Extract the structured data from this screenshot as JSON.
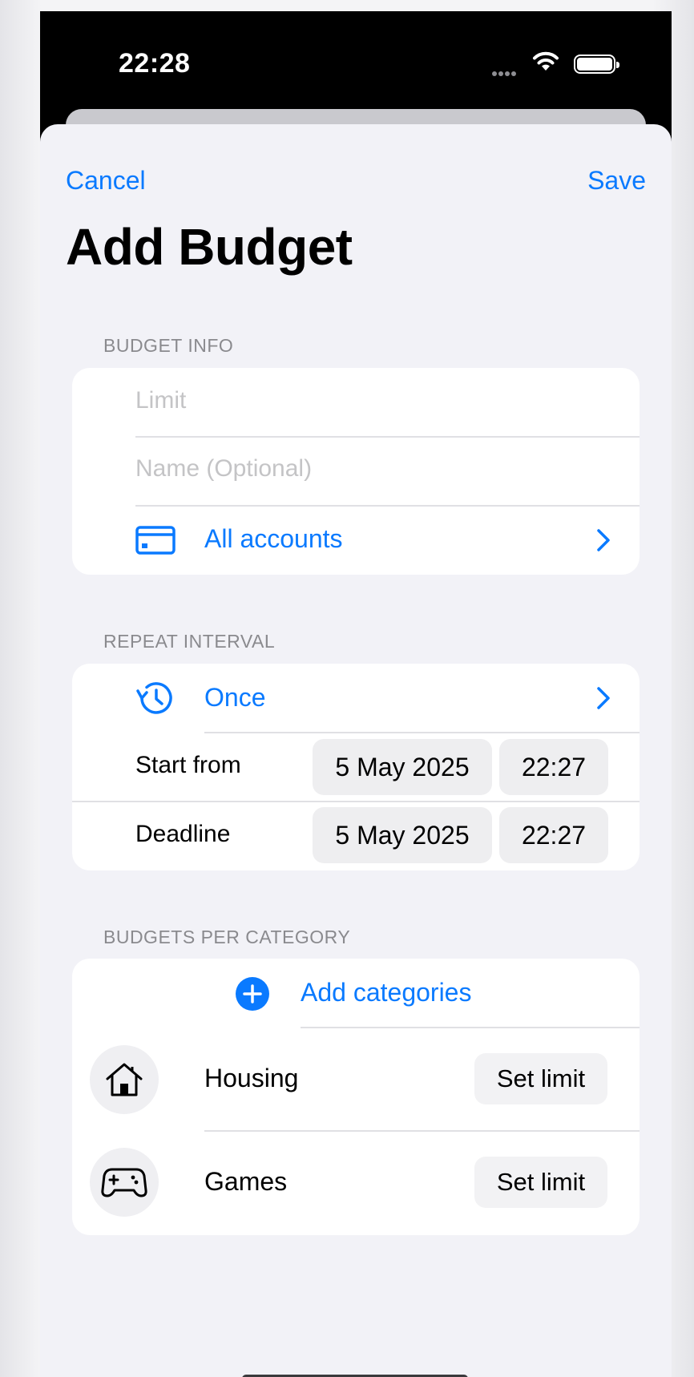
{
  "status": {
    "time": "22:28"
  },
  "nav": {
    "cancel": "Cancel",
    "save": "Save",
    "title": "Add Budget"
  },
  "budget_info": {
    "header": "BUDGET INFO",
    "limit_placeholder": "Limit",
    "name_placeholder": "Name (Optional)",
    "accounts_label": "All accounts"
  },
  "repeat_interval": {
    "header": "REPEAT INTERVAL",
    "interval_label": "Once",
    "start_label": "Start from",
    "start_date": "5 May 2025",
    "start_time": "22:27",
    "deadline_label": "Deadline",
    "deadline_date": "5 May 2025",
    "deadline_time": "22:27"
  },
  "categories": {
    "header": "BUDGETS PER CATEGORY",
    "add_label": "Add categories",
    "items": [
      {
        "name": "Housing",
        "icon": "house-icon",
        "action": "Set limit"
      },
      {
        "name": "Games",
        "icon": "gamepad-icon",
        "action": "Set limit"
      }
    ]
  },
  "colors": {
    "accent": "#0a7aff",
    "background": "#f2f2f7",
    "card": "#ffffff"
  }
}
